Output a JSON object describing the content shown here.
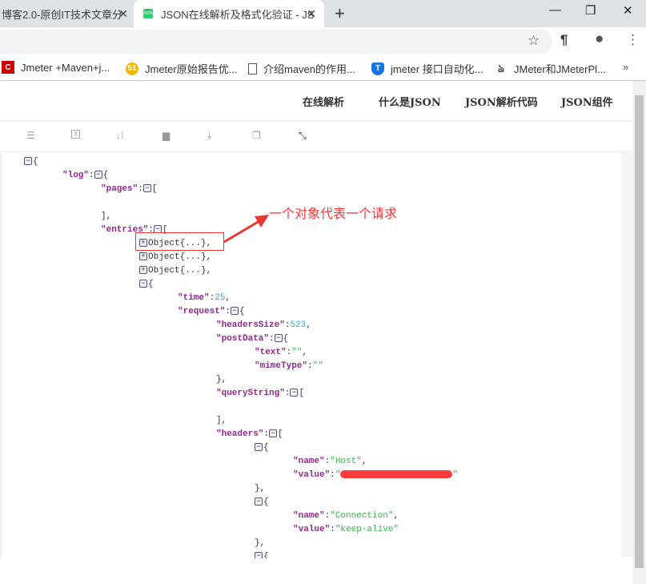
{
  "browser": {
    "tabs": [
      {
        "title": "博客2.0-原创IT技术文章分"
      },
      {
        "title": "JSON在线解析及格式化验证 - JS",
        "favicon": "JSON"
      }
    ],
    "new_tab": "+",
    "window": {
      "minimize": "—",
      "restore": "❐",
      "close": "✕"
    },
    "bookmarks": [
      {
        "label": "Jmeter +Maven+j...",
        "icon": "C",
        "color": "#cc0000"
      },
      {
        "label": "Jmeter原始报告优...",
        "icon": "51",
        "color": "#f5b800"
      },
      {
        "label": "介绍maven的作用...",
        "icon": "page-icon"
      },
      {
        "label": "jmeter 接口自动化...",
        "icon": "T",
        "color": "#1a73e8"
      },
      {
        "label": "JMeter和JMeterPl...",
        "icon": "feather-icon"
      }
    ],
    "more": "»"
  },
  "nav": [
    "在线解析",
    "什么是JSON",
    "JSON解析代码",
    "JSON组件"
  ],
  "tools": [
    "database-icon",
    "excel-icon",
    "sort-icon",
    "trash-icon",
    "download-icon",
    "copy-icon",
    "compress-icon"
  ],
  "annotation": "一个对象代表一个请求",
  "json_lines": [
    {
      "i": 0,
      "t": "-",
      "s": "{"
    },
    {
      "i": 1,
      "k": "log",
      "t": "-",
      "s": "{"
    },
    {
      "i": 2,
      "k": "pages",
      "t": "-",
      "s": "["
    },
    {
      "i": 2,
      "s": ""
    },
    {
      "i": 2,
      "s": "],"
    },
    {
      "i": 2,
      "k": "entries",
      "t": "-",
      "s": "["
    },
    {
      "i": 3,
      "t": "+",
      "s": "Object{...},"
    },
    {
      "i": 3,
      "t": "+",
      "s": "Object{...},"
    },
    {
      "i": 3,
      "t": "+",
      "s": "Object{...},"
    },
    {
      "i": 3,
      "t": "-",
      "s": "{"
    },
    {
      "i": 4,
      "k": "time",
      "v": "25",
      "vt": "num",
      "s": ","
    },
    {
      "i": 4,
      "k": "request",
      "t": "-",
      "s": "{"
    },
    {
      "i": 5,
      "k": "headersSize",
      "v": "523",
      "vt": "num",
      "s": ","
    },
    {
      "i": 5,
      "k": "postData",
      "t": "-",
      "s": "{"
    },
    {
      "i": 6,
      "k": "text",
      "v": "\"\"",
      "vt": "str",
      "s": ","
    },
    {
      "i": 6,
      "k": "mimeType",
      "v": "\"\"",
      "vt": "str",
      "s": ""
    },
    {
      "i": 5,
      "s": "},"
    },
    {
      "i": 5,
      "k": "queryString",
      "t": "-",
      "s": "["
    },
    {
      "i": 5,
      "s": ""
    },
    {
      "i": 5,
      "s": "],"
    },
    {
      "i": 5,
      "k": "headers",
      "t": "-",
      "s": "["
    },
    {
      "i": 6,
      "t": "-",
      "s": "{"
    },
    {
      "i": 7,
      "k": "name",
      "v": "\"Host\"",
      "vt": "str",
      "s": ","
    },
    {
      "i": 7,
      "k": "value",
      "vt": "redacted",
      "s": ""
    },
    {
      "i": 6,
      "s": "},"
    },
    {
      "i": 6,
      "t": "-",
      "s": "{"
    },
    {
      "i": 7,
      "k": "name",
      "v": "\"Connection\"",
      "vt": "str",
      "s": ","
    },
    {
      "i": 7,
      "k": "value",
      "v": "\"keep-alive\"",
      "vt": "str",
      "s": ""
    },
    {
      "i": 6,
      "s": "},"
    },
    {
      "i": 6,
      "t": "-",
      "s": "{"
    }
  ]
}
